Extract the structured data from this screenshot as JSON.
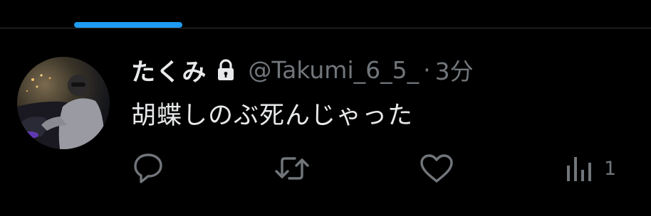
{
  "tabs": {
    "active_indicator_color": "#1d9bf0"
  },
  "tweet": {
    "display_name": "たくみ",
    "protected_icon": "lock-icon",
    "handle": "@Takumi_6_5_",
    "separator": "·",
    "timestamp": "3分",
    "text": "胡蝶しのぶ死んじゃった"
  },
  "actions": {
    "reply": {
      "icon": "reply-icon"
    },
    "retweet": {
      "icon": "retweet-icon"
    },
    "like": {
      "icon": "heart-icon"
    },
    "analytics": {
      "icon": "analytics-icon",
      "count": "1"
    }
  },
  "colors": {
    "background": "#000000",
    "text_primary": "#e7e9ea",
    "text_secondary": "#71767b",
    "accent": "#1d9bf0",
    "divider": "#2f3336"
  }
}
